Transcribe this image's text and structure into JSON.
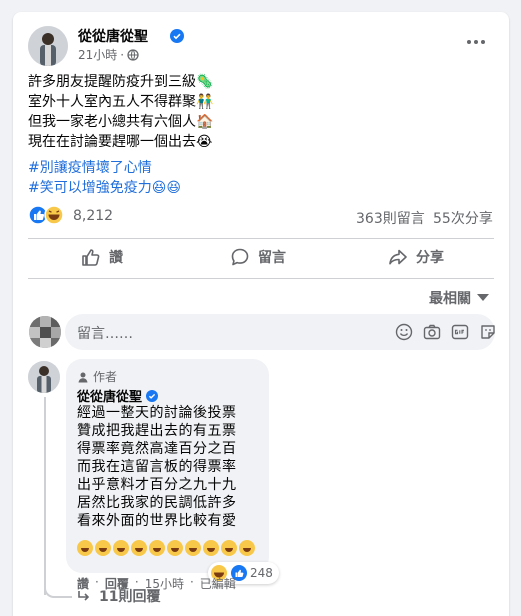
{
  "post": {
    "author": "從從唐從聖",
    "time": "21小時",
    "lines": [
      "許多朋友提醒防疫升到三級",
      "室外十人室內五人不得群聚",
      "但我一家老小總共有六個人",
      "現在在討論要趕哪一個出去"
    ],
    "line_emojis": [
      "🦠",
      "👬",
      "🏠",
      "😭"
    ],
    "hashtags": [
      "#別讓疫情壞了心情",
      "#笑可以增強免疫力"
    ],
    "hashtag_suffix": "😆😆"
  },
  "stats": {
    "reaction_count": "8,212",
    "comments": "363則留言",
    "shares": "55次分享"
  },
  "actions": {
    "like": "讚",
    "comment": "留言",
    "share": "分享"
  },
  "sort": {
    "label": "最相關"
  },
  "comment_box": {
    "placeholder": "留言……"
  },
  "top_comment": {
    "badge": "作者",
    "author": "從從唐從聖",
    "lines": [
      "經過一整天的討論後投票",
      "贊成把我趕出去的有五票",
      "得票率竟然高達百分之百",
      "而我在這留言板的得票率",
      "出乎意料才百分之九十九",
      "居然比我家的民調低許多",
      "看來外面的世界比較有愛"
    ],
    "emoji_count": 10,
    "reaction_count": "248",
    "like_label": "讚",
    "reply_label": "回覆",
    "time": "15小時",
    "edited": "已編輯"
  },
  "replies": {
    "label": "11則回覆"
  },
  "colors": {
    "link": "#216fdb",
    "muted": "#65676b",
    "verified": "#1877f2",
    "bg": "#f0f2f5"
  }
}
